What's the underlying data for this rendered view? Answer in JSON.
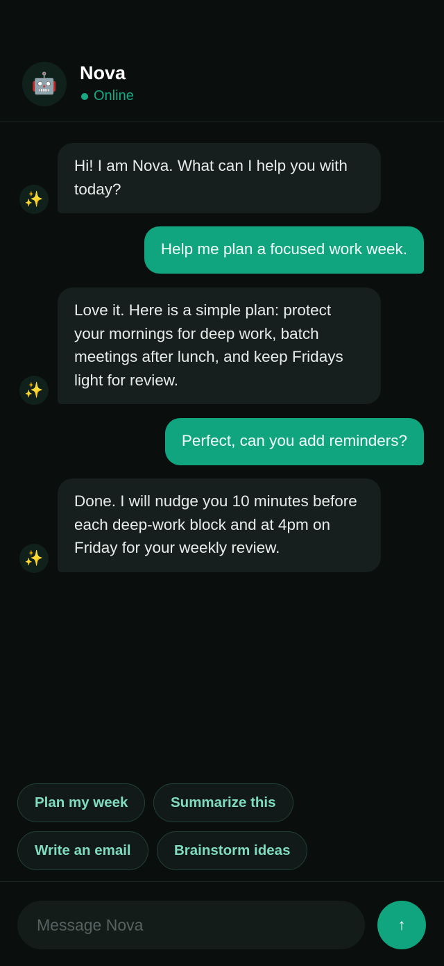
{
  "header": {
    "avatar_emoji": "🤖",
    "name": "Nova",
    "status": "Online"
  },
  "messages": [
    {
      "from": "bot",
      "avatar": "✨",
      "text": "Hi! I am Nova. What can I help you with today?"
    },
    {
      "from": "user",
      "text": "Help me plan a focused work week."
    },
    {
      "from": "bot",
      "avatar": "✨",
      "text": "Love it. Here is a simple plan: protect your mornings for deep work, batch meetings after lunch, and keep Fridays light for review."
    },
    {
      "from": "user",
      "text": "Perfect, can you add reminders?"
    },
    {
      "from": "bot",
      "avatar": "✨",
      "text": "Done. I will nudge you 10 minutes before each deep-work block and at 4pm on Friday for your weekly review."
    }
  ],
  "suggestions": [
    "Plan my week",
    "Summarize this",
    "Write an email",
    "Brainstorm ideas"
  ],
  "composer": {
    "placeholder": "Message Nova",
    "send_icon": "↑"
  },
  "colors": {
    "background": "#0a0f0e",
    "accent": "#10a47f",
    "bot_bubble": "#161f1d",
    "status": "#17a884",
    "chip_text": "#7fdcbe"
  }
}
